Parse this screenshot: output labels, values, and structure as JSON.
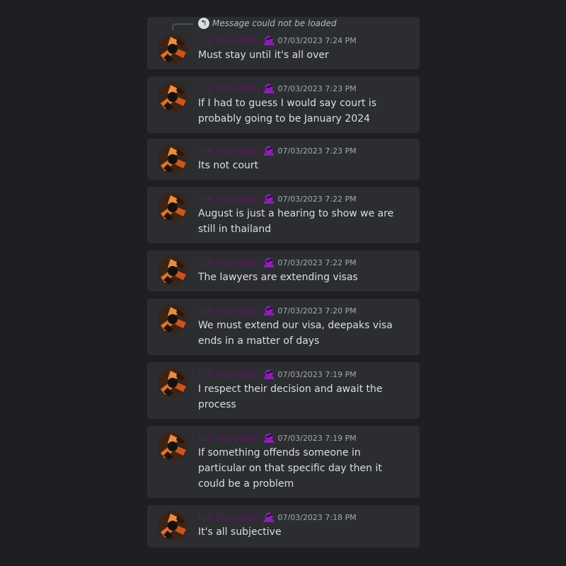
{
  "reply_notice": "Message could not be loaded",
  "username_color": "#5b1a5e",
  "badge_color": "#8a1fb5",
  "messages": [
    {
      "username": "Ice Poseidon",
      "timestamp": "07/03/2023 7:24 PM",
      "text": "Must stay until it's all over"
    },
    {
      "username": "Ice Poseidon",
      "timestamp": "07/03/2023 7:23 PM",
      "text": "If I had to guess I would say court is probably going to be January 2024"
    },
    {
      "username": "Ice Poseidon",
      "timestamp": "07/03/2023 7:23 PM",
      "text": "Its not court"
    },
    {
      "username": "Ice Poseidon",
      "timestamp": "07/03/2023 7:22 PM",
      "text": "August is just a hearing to show we are still in thailand"
    },
    {
      "username": "Ice Poseidon",
      "timestamp": "07/03/2023 7:22 PM",
      "text": "The lawyers are extending visas"
    },
    {
      "username": "Ice Poseidon",
      "timestamp": "07/03/2023 7:20 PM",
      "text": "We must extend our visa, deepaks visa ends in a matter of days"
    },
    {
      "username": "Ice Poseidon",
      "timestamp": "07/03/2023 7:19 PM",
      "text": "I respect their decision and await the process"
    },
    {
      "username": "Ice Poseidon",
      "timestamp": "07/03/2023 7:19 PM",
      "text": "If something offends someone in particular on that specific day then it could be a problem"
    },
    {
      "username": "Ice Poseidon",
      "timestamp": "07/03/2023 7:18 PM",
      "text": "It's all subjective"
    }
  ]
}
